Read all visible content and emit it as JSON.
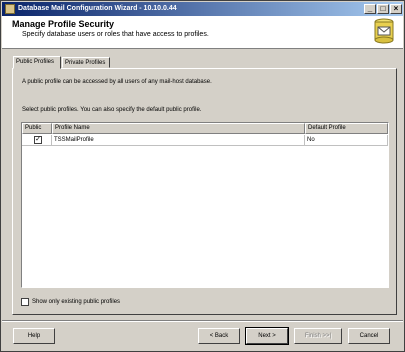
{
  "window": {
    "title": "Database Mail Configuration Wizard - 10.10.0.44"
  },
  "header": {
    "title": "Manage Profile Security",
    "subtitle": "Specify database users or roles that have access to profiles."
  },
  "tabs": [
    {
      "label": "Public Profiles",
      "active": true
    },
    {
      "label": "Private Profiles",
      "active": false
    }
  ],
  "main": {
    "description": "A public profile can be accessed by all users of any mail-host database.",
    "instruction": "Select public profiles. You can also specify the default public profile.",
    "grid": {
      "columns": [
        "Public",
        "Profile Name",
        "Default Profile"
      ],
      "rows": [
        {
          "public": true,
          "public_mark": "✓",
          "profile_name": "TSSMailProfile",
          "default_profile": "No"
        }
      ]
    },
    "show_existing_label": "Show only existing public profiles",
    "show_existing_checked": false
  },
  "buttons": {
    "help": "Help",
    "back": "< Back",
    "next": "Next >",
    "finish": "Finish >>|",
    "cancel": "Cancel"
  }
}
